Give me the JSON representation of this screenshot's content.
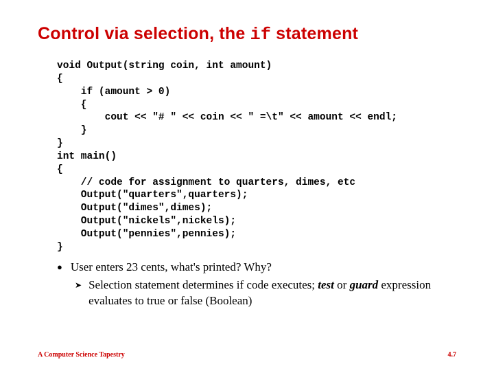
{
  "title_pre": "Control via selection, the ",
  "title_mono": "if",
  "title_post": " statement",
  "code": "void Output(string coin, int amount)\n{\n    if (amount > 0)\n    {\n        cout << \"# \" << coin << \" =\\t\" << amount << endl;\n    }\n}\nint main()\n{\n    // code for assignment to quarters, dimes, etc\n    Output(\"quarters\",quarters);\n    Output(\"dimes\",dimes);\n    Output(\"nickels\",nickels);\n    Output(\"pennies\",pennies);\n}",
  "bullet1": "User enters 23 cents, what's printed? Why?",
  "subbullet_pre": "Selection statement determines if code executes; ",
  "subbullet_test": "test",
  "subbullet_or": " or ",
  "subbullet_guard": "guard",
  "subbullet_rest": " expression evaluates to true or false (Boolean)",
  "footer_left": "A Computer Science Tapestry",
  "footer_right": "4.7"
}
